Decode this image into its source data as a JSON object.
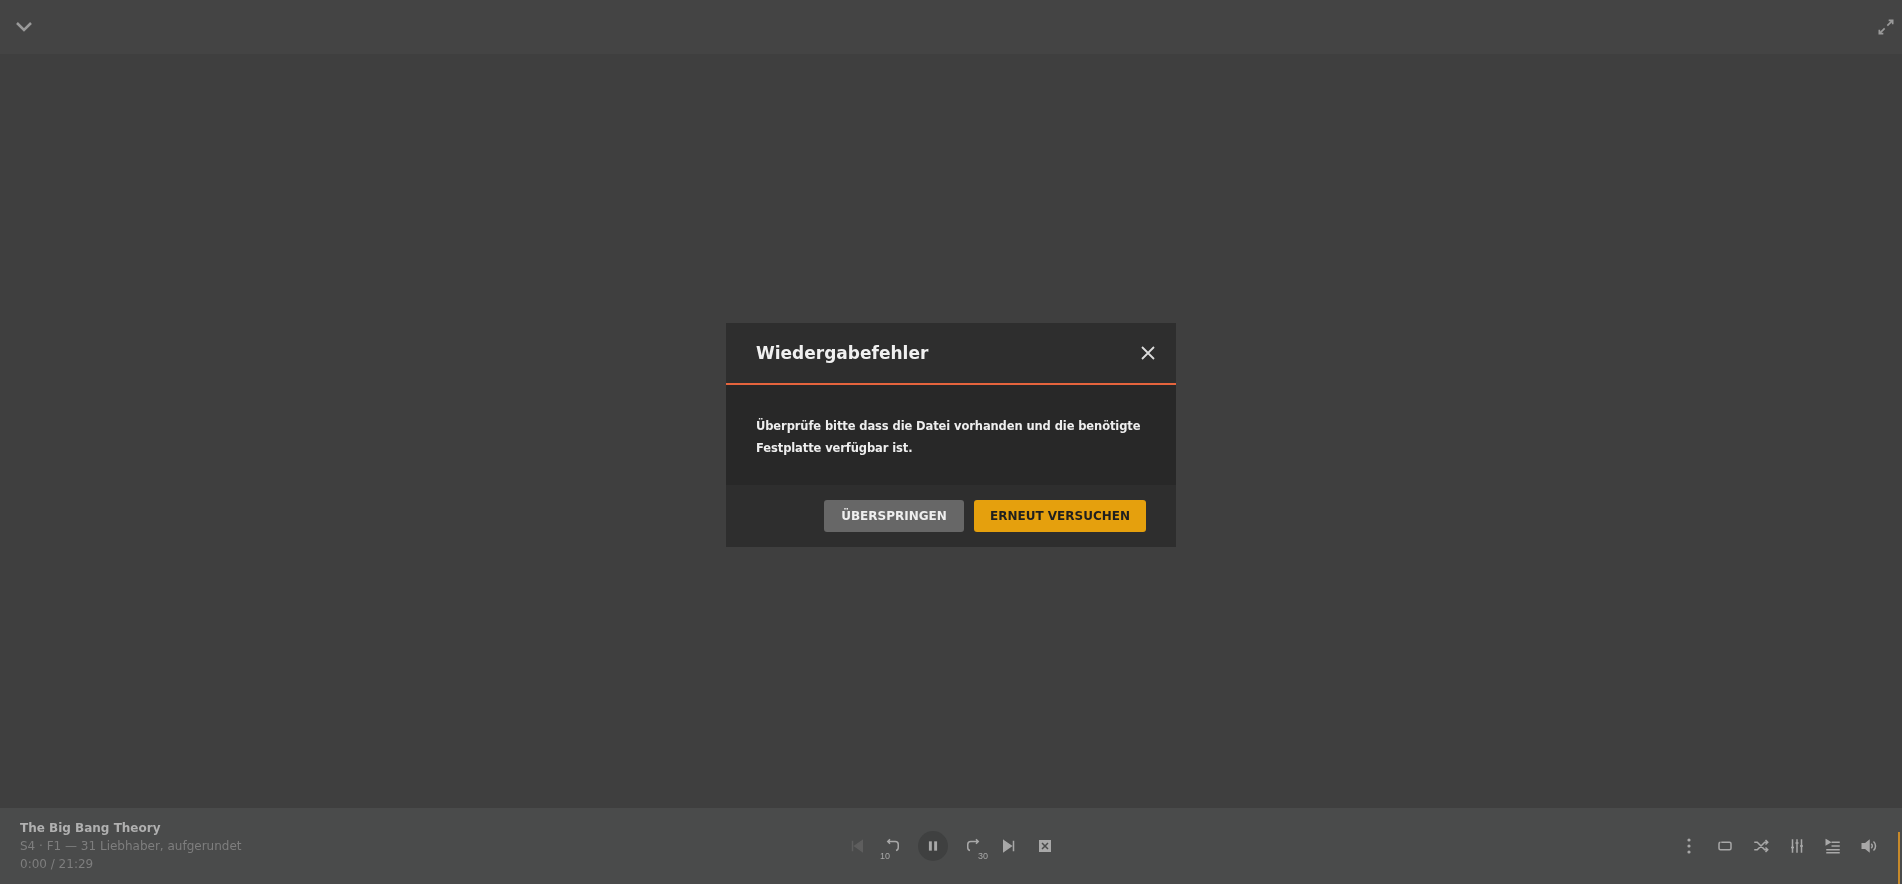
{
  "dialog": {
    "title": "Wiedergabefehler",
    "message": "Überprüfe bitte dass die Datei vorhanden und die benötigte Festplatte verfügbar ist.",
    "buttons": [
      {
        "label": "ÜBERSPRINGEN",
        "kind": "secondary"
      },
      {
        "label": "ERNEUT VERSUCHEN",
        "kind": "primary"
      }
    ]
  },
  "now_playing": {
    "title": "The Big Bang Theory",
    "episode": "S4 · F1 — 31 Liebhaber, aufgerundet",
    "time": "0:00 / 21:29"
  },
  "transport": [
    {
      "kind": "previous",
      "disabled": true
    },
    {
      "kind": "rewind",
      "label": "10",
      "disabled": false
    },
    {
      "kind": "pause",
      "disabled": false
    },
    {
      "kind": "forward",
      "label": "30",
      "disabled": false
    },
    {
      "kind": "next",
      "disabled": false
    },
    {
      "kind": "stop",
      "disabled": false
    }
  ],
  "tools": [
    {
      "kind": "more"
    },
    {
      "kind": "repeat"
    },
    {
      "kind": "shuffle"
    },
    {
      "kind": "equalizer"
    },
    {
      "kind": "queue"
    },
    {
      "kind": "volume"
    }
  ]
}
